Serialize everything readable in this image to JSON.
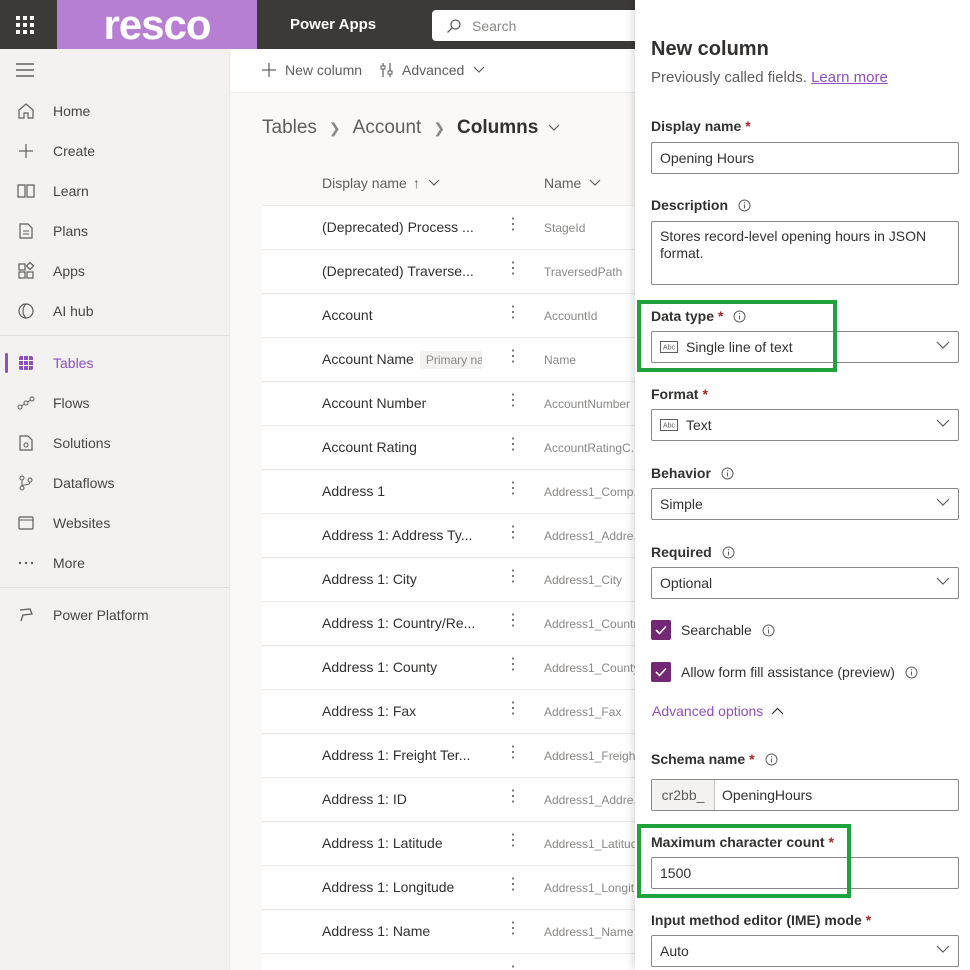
{
  "topbar": {
    "brand": "resco",
    "app_name": "Power Apps",
    "search_placeholder": "Search"
  },
  "leftnav": {
    "items": [
      {
        "label": "Home",
        "icon": "home-icon"
      },
      {
        "label": "Create",
        "icon": "plus-icon"
      },
      {
        "label": "Learn",
        "icon": "book-icon"
      },
      {
        "label": "Plans",
        "icon": "plans-icon"
      },
      {
        "label": "Apps",
        "icon": "apps-icon"
      },
      {
        "label": "AI hub",
        "icon": "ai-hub-icon"
      },
      {
        "label": "Tables",
        "icon": "table-icon",
        "active": true
      },
      {
        "label": "Flows",
        "icon": "flows-icon"
      },
      {
        "label": "Solutions",
        "icon": "solutions-icon"
      },
      {
        "label": "Dataflows",
        "icon": "dataflows-icon"
      },
      {
        "label": "Websites",
        "icon": "websites-icon"
      },
      {
        "label": "More",
        "icon": "more-icon"
      },
      {
        "label": "Power Platform",
        "icon": "power-platform-icon"
      }
    ]
  },
  "cmdbar": {
    "new_column": "New column",
    "advanced": "Advanced"
  },
  "breadcrumb": [
    "Tables",
    "Account",
    "Columns"
  ],
  "table": {
    "headers": {
      "display_name": "Display name",
      "sort_arrow": "↑",
      "name": "Name"
    },
    "rows": [
      {
        "display": "(Deprecated) Process ...",
        "name": "StageId"
      },
      {
        "display": "(Deprecated) Traverse...",
        "name": "TraversedPath"
      },
      {
        "display": "Account",
        "name": "AccountId"
      },
      {
        "display": "Account Name",
        "badge": "Primary na",
        "name": "Name"
      },
      {
        "display": "Account Number",
        "name": "AccountNumber"
      },
      {
        "display": "Account Rating",
        "name": "AccountRatingC..."
      },
      {
        "display": "Address 1",
        "name": "Address1_Comp..."
      },
      {
        "display": "Address 1: Address Ty...",
        "name": "Address1_Addre..."
      },
      {
        "display": "Address 1: City",
        "name": "Address1_City"
      },
      {
        "display": "Address 1: Country/Re...",
        "name": "Address1_Countr"
      },
      {
        "display": "Address 1: County",
        "name": "Address1_County"
      },
      {
        "display": "Address 1: Fax",
        "name": "Address1_Fax"
      },
      {
        "display": "Address 1: Freight Ter...",
        "name": "Address1_Freight"
      },
      {
        "display": "Address 1: ID",
        "name": "Address1_Addre..."
      },
      {
        "display": "Address 1: Latitude",
        "name": "Address1_Latitud"
      },
      {
        "display": "Address 1: Longitude",
        "name": "Address1_Longit..."
      },
      {
        "display": "Address 1: Name",
        "name": "Address1_Name"
      }
    ]
  },
  "panel": {
    "title": "New column",
    "subtitle": "Previously called fields.",
    "learn_more": "Learn more",
    "display_name_label": "Display name",
    "display_name_value": "Opening Hours",
    "description_label": "Description",
    "description_value": "Stores record-level opening hours in JSON format.",
    "data_type_label": "Data type",
    "data_type_value": "Single line of text",
    "format_label": "Format",
    "format_value": "Text",
    "behavior_label": "Behavior",
    "behavior_value": "Simple",
    "required_label": "Required",
    "required_value": "Optional",
    "searchable_label": "Searchable",
    "searchable_checked": true,
    "form_fill_label": "Allow form fill assistance (preview)",
    "form_fill_checked": true,
    "advanced_options": "Advanced options",
    "schema_name_label": "Schema name",
    "schema_prefix": "cr2bb_",
    "schema_value": "OpeningHours",
    "max_chars_label": "Maximum character count",
    "max_chars_value": "1500",
    "ime_label": "Input method editor (IME) mode",
    "ime_value": "Auto",
    "required_marker": "*"
  },
  "colors": {
    "topbar": "#3b3a39",
    "brand": "#b77fd3",
    "accent": "#8e4fc0",
    "checkbox": "#742774",
    "highlight": "#1fa33d",
    "required": "#a4262c"
  }
}
